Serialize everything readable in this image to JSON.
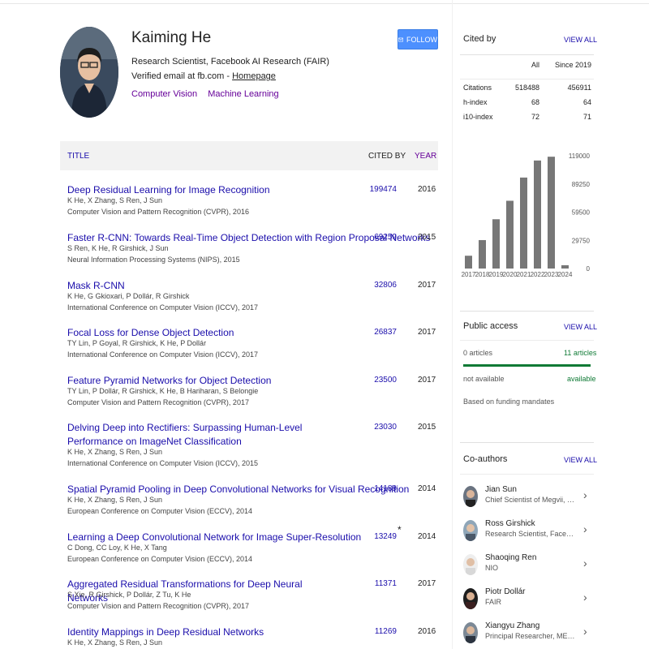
{
  "profile": {
    "name": "Kaiming He",
    "affiliation": "Research Scientist, Facebook AI Research (FAIR)",
    "verified_prefix": "Verified email at fb.com - ",
    "homepage": "Homepage",
    "interests": [
      "Computer Vision",
      "Machine Learning"
    ],
    "follow_label": "FOLLOW"
  },
  "table": {
    "headers": {
      "title": "TITLE",
      "cited_by": "CITED BY",
      "year": "YEAR"
    },
    "articles": [
      {
        "title": "Deep Residual Learning for Image Recognition",
        "authors": "K He, X Zhang, S Ren, J Sun",
        "venue": "Computer Vision and Pattern Recognition (CVPR), 2016",
        "cited": "199474",
        "year": "2016",
        "star": ""
      },
      {
        "title": "Faster R-CNN: Towards Real-Time Object Detection with Region Proposal Networks",
        "authors": "S Ren, K He, R Girshick, J Sun",
        "venue": "Neural Information Processing Systems (NIPS), 2015",
        "cited": "69259",
        "year": "2015",
        "star": ""
      },
      {
        "title": "Mask R-CNN",
        "authors": "K He, G Gkioxari, P Dollár, R Girshick",
        "venue": "International Conference on Computer Vision (ICCV), 2017",
        "cited": "32806",
        "year": "2017",
        "star": ""
      },
      {
        "title": "Focal Loss for Dense Object Detection",
        "authors": "TY Lin, P Goyal, R Girshick, K He, P Dollár",
        "venue": "International Conference on Computer Vision (ICCV), 2017",
        "cited": "26837",
        "year": "2017",
        "star": ""
      },
      {
        "title": "Feature Pyramid Networks for Object Detection",
        "authors": "TY Lin, P Dollár, R Girshick, K He, B Hariharan, S Belongie",
        "venue": "Computer Vision and Pattern Recognition (CVPR), 2017",
        "cited": "23500",
        "year": "2017",
        "star": ""
      },
      {
        "title": "Delving Deep into Rectifiers: Surpassing Human-Level Performance on ImageNet Classification",
        "authors": "K He, X Zhang, S Ren, J Sun",
        "venue": "International Conference on Computer Vision (ICCV), 2015",
        "cited": "23030",
        "year": "2015",
        "star": ""
      },
      {
        "title": "Spatial Pyramid Pooling in Deep Convolutional Networks for Visual Recognition",
        "authors": "K He, X Zhang, S Ren, J Sun",
        "venue": "European Conference on Computer Vision (ECCV), 2014",
        "cited": "14189",
        "year": "2014",
        "star": ""
      },
      {
        "title": "Learning a Deep Convolutional Network for Image Super-Resolution",
        "authors": "C Dong, CC Loy, K He, X Tang",
        "venue": "European Conference on Computer Vision (ECCV), 2014",
        "cited": "13249",
        "year": "2014",
        "star": "*"
      },
      {
        "title": "Aggregated Residual Transformations for Deep Neural Networks",
        "authors": "S Xie, R Girshick, P Dollár, Z Tu, K He",
        "venue": "Computer Vision and Pattern Recognition (CVPR), 2017",
        "cited": "11371",
        "year": "2017",
        "star": ""
      },
      {
        "title": "Identity Mappings in Deep Residual Networks",
        "authors": "K He, X Zhang, S Ren, J Sun",
        "venue": "",
        "cited": "11269",
        "year": "2016",
        "star": ""
      }
    ]
  },
  "cited_by": {
    "title": "Cited by",
    "view_all": "VIEW ALL",
    "col_all": "All",
    "col_since": "Since 2019",
    "rows": [
      {
        "label": "Citations",
        "all": "518488",
        "since": "456911"
      },
      {
        "label": "h-index",
        "all": "68",
        "since": "64"
      },
      {
        "label": "i10-index",
        "all": "72",
        "since": "71"
      }
    ]
  },
  "chart_data": {
    "type": "bar",
    "categories": [
      "2017",
      "2018",
      "2019",
      "2020",
      "2021",
      "2022",
      "2023",
      "2024"
    ],
    "values": [
      13500,
      30000,
      52000,
      71500,
      96000,
      114000,
      118000,
      3500
    ],
    "ylim": [
      0,
      119000
    ],
    "yticks": [
      "119000",
      "89250",
      "59500",
      "29750",
      "0"
    ],
    "y_axis_position": "right",
    "grid": false,
    "bar_color": "#777777"
  },
  "public_access": {
    "title": "Public access",
    "view_all": "VIEW ALL",
    "left_count": "0 articles",
    "right_count": "11 articles",
    "left_label": "not available",
    "right_label": "available",
    "note": "Based on funding mandates"
  },
  "coauthors": {
    "title": "Co-authors",
    "view_all": "VIEW ALL",
    "items": [
      {
        "name": "Jian Sun",
        "affiliation": "Chief Scientist of Megvii, Managi..."
      },
      {
        "name": "Ross Girshick",
        "affiliation": "Research Scientist, Facebook AI..."
      },
      {
        "name": "Shaoqing Ren",
        "affiliation": "NIO"
      },
      {
        "name": "Piotr Dollár",
        "affiliation": "FAIR"
      },
      {
        "name": "Xiangyu Zhang",
        "affiliation": "Principal Researcher, MEGVII Te..."
      }
    ]
  },
  "colors": {
    "link": "#1a0dab",
    "visited": "#660099",
    "follow": "#4d90fe",
    "available": "#0f7a35"
  }
}
